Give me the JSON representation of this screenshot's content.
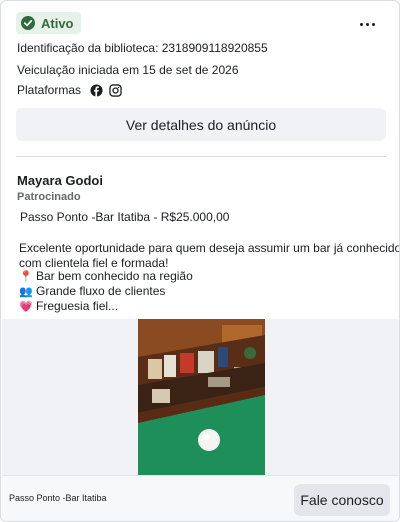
{
  "status": {
    "label": "Ativo",
    "color": "#2f6b3b",
    "icon": "check-circle-icon"
  },
  "more_menu": {
    "icon": "more-horizontal-icon"
  },
  "library_id_text": "Identificação da biblioteca: 2318909118920855",
  "started_text": "Veiculação iniciada em 15 de set de 2026",
  "platforms": {
    "label": "Plataformas",
    "icons": [
      "facebook-icon",
      "instagram-icon"
    ]
  },
  "details_button_label": "Ver detalhes do anúncio",
  "advertiser": {
    "name": "Mayara Godoi",
    "sponsored_label": "Patrocinado"
  },
  "ad_body": {
    "headline": "Passo Ponto -Bar Itatiba - R$25.000,00",
    "paragraph_line1": "Excelente oportunidade para quem deseja assumir um bar já conhecido e",
    "paragraph_line2": "com clientela fiel e formada!",
    "bullets": [
      {
        "emoji": "📍",
        "text": "Bar bem conhecido na região"
      },
      {
        "emoji": "👥",
        "text": "Grande fluxo de clientes"
      },
      {
        "emoji": "💗",
        "text": "Freguesia fiel..."
      }
    ]
  },
  "footer": {
    "caption": "Passo Ponto -Bar Itatiba",
    "cta_label": "Fale conosco"
  }
}
